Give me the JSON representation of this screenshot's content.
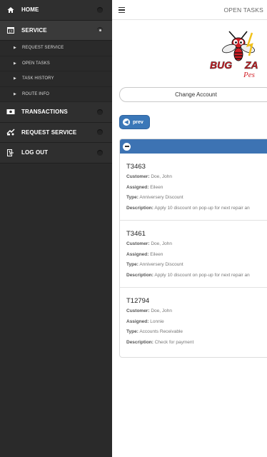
{
  "sidebar": {
    "items": [
      {
        "label": "HOME",
        "icon": "home-icon"
      },
      {
        "label": "SERVICE",
        "icon": "calendar-icon"
      },
      {
        "label": "TRANSACTIONS",
        "icon": "money-icon"
      },
      {
        "label": "REQUEST SERVICE",
        "icon": "truck-icon"
      },
      {
        "label": "LOG OUT",
        "icon": "logout-icon"
      }
    ],
    "sub_items": [
      "REQUEST SERVICE",
      "OPEN TASKS",
      "TASK HISTORY",
      "ROUTE INFO"
    ]
  },
  "topbar": {
    "title": "OPEN TASKS"
  },
  "logo": {
    "line1": "BUG",
    "line2": "ZA",
    "line3": "Pes"
  },
  "change_account_label": "Change Account",
  "prev_label": "prev",
  "labels": {
    "customer": "Customer:",
    "assigned": "Assigned:",
    "type": "Type:",
    "description": "Description:"
  },
  "tasks": [
    {
      "id": "T3463",
      "customer": "Doe, John",
      "assigned": "Eileen",
      "type": "Anniversery Discount",
      "description": "Apply 10 discount on pop-up for next repair an"
    },
    {
      "id": "T3461",
      "customer": "Doe, John",
      "assigned": "Eileen",
      "type": "Anniversery Discount",
      "description": "Apply 10 discount on pop-up for next repair an"
    },
    {
      "id": "T12794",
      "customer": "Doe, John",
      "assigned": "Lonnie",
      "type": "Accounts Receivable",
      "description": "Check for payment"
    }
  ],
  "colors": {
    "accent": "#3d73b3",
    "sidebar": "#2a2a2a",
    "logo_red": "#d21f26"
  }
}
